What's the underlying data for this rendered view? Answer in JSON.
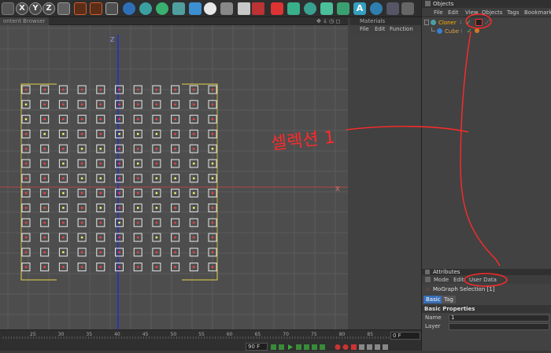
{
  "toolbar": {
    "axes": [
      "X",
      "Y",
      "Z"
    ],
    "icons": [
      "lock-icon",
      "undo-icon",
      "redo-icon",
      "render-icon",
      "coordinate-icon",
      "cube-icon",
      "cloner-icon",
      "generator-icon",
      "light-icon",
      "sparkle-icon",
      "camera-icon",
      "settings-icon",
      "film-icon",
      "primitive-icon",
      "tag-icon",
      "effector-icon",
      "spline-icon",
      "text-icon",
      "dots-icon",
      "pivot-icon"
    ]
  },
  "viewport": {
    "tab_label": "ontent Browser",
    "axis_z": "Z",
    "axis_x": "X",
    "ruler_ticks": [
      "25",
      "30",
      "35",
      "40",
      "45",
      "50",
      "55",
      "60",
      "65",
      "70",
      "75",
      "80",
      "85",
      "90"
    ],
    "frame_field": "0 F",
    "end_frame_field": "90 F"
  },
  "materials": {
    "title": "Materials",
    "menu": [
      "File",
      "Edit",
      "Function"
    ]
  },
  "objects": {
    "title": "Objects",
    "menu": [
      "File",
      "Edit",
      "View",
      "Objects",
      "Tags",
      "Bookmarks"
    ],
    "tree": [
      {
        "name": "Cloner",
        "color": "#ffb000"
      },
      {
        "name": "Cube",
        "color": "#d9a44a"
      }
    ]
  },
  "attributes": {
    "title": "Attributes",
    "menu": [
      "Mode",
      "Edit",
      "User Data"
    ],
    "object_name": "MoGraph Selection [1]",
    "tabs": [
      "Basic",
      "Tag"
    ],
    "section": "Basic Properties",
    "fields": [
      {
        "label": "Name",
        "value": "1"
      },
      {
        "label": "Layer",
        "value": ""
      }
    ]
  },
  "annotation": {
    "handwriting": "셀렉션 1"
  },
  "colors": {
    "accent_red": "#ff2a2a",
    "selection_yellow": "#ffff66",
    "grid_line": "#5a5a5a",
    "axis_blue": "#1d2fd0"
  }
}
